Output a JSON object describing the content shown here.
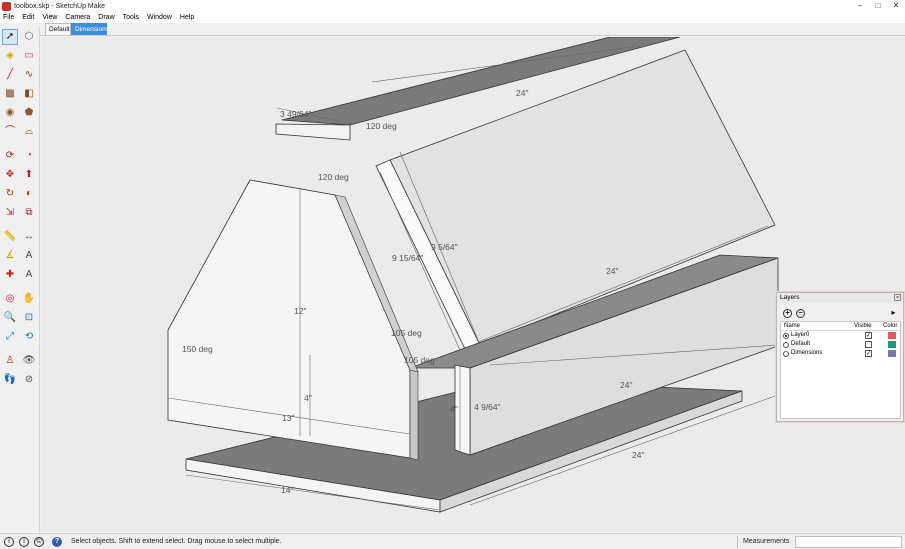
{
  "window": {
    "title": "toolbox.skp - SketchUp Make",
    "controls": {
      "minimize": "–",
      "maximize": "□",
      "close": "✕"
    }
  },
  "menu": {
    "items": [
      "File",
      "Edit",
      "View",
      "Camera",
      "Draw",
      "Tools",
      "Window",
      "Help"
    ]
  },
  "scenes": {
    "tabs": [
      {
        "label": "Default",
        "active": false
      },
      {
        "label": "Dimensions",
        "active": true
      }
    ]
  },
  "toolbar": {
    "tools": [
      "select-icon",
      "component-icon",
      "paint-bucket-icon",
      "eraser-icon",
      "line-icon",
      "freehand-icon",
      "rectangle-icon",
      "rotated-rectangle-icon",
      "circle-icon",
      "polygon-icon",
      "arc-icon",
      "two-point-arc-icon",
      "three-point-arc-icon",
      "pie-icon",
      "move-icon",
      "push-pull-icon",
      "rotate-icon",
      "follow-me-icon",
      "scale-icon",
      "offset-icon",
      "tape-measure-icon",
      "dimension-icon",
      "protractor-icon",
      "text-icon",
      "axes-icon",
      "3d-text-icon",
      "orbit-icon",
      "pan-icon",
      "zoom-icon",
      "zoom-window-icon",
      "zoom-extents-icon",
      "previous-view-icon",
      "position-camera-icon",
      "look-around-icon",
      "walk-icon",
      "section-plane-icon"
    ]
  },
  "viewport": {
    "background_color": "#ebebeb",
    "dimensions": {
      "top_width": "3 49/64\"",
      "top_angle": "120 deg",
      "top_length": "24\"",
      "side_angle": "120 deg",
      "side_panel_length": "24\"",
      "side_panel_width": "9 5/64\"",
      "slant_height": "9 15/64\"",
      "end_height": "12\"",
      "end_left_angle": "150 deg",
      "end_lower_height": "4\"",
      "end_width": "13\"",
      "front_angle_a": "105 deg",
      "front_angle_b": "105 deg",
      "front_height": "4\"",
      "front_board_height": "4 9/64\"",
      "front_length": "24\"",
      "base_length": "24\"",
      "base_width": "14\""
    }
  },
  "layers_panel": {
    "title": "Layers",
    "add_button": "+",
    "remove_button": "−",
    "details_button": "▸",
    "columns": {
      "name": "Name",
      "visible": "Visible",
      "color": "Color"
    },
    "rows": [
      {
        "name": "Layer0",
        "active": true,
        "visible": true,
        "color": "#e05a5a"
      },
      {
        "name": "Default",
        "active": false,
        "visible": false,
        "color": "#1a9a7a"
      },
      {
        "name": "Dimensions",
        "active": false,
        "visible": true,
        "color": "#7a7aa8"
      }
    ]
  },
  "statusbar": {
    "hint": "Select objects. Shift to extend select. Drag mouse to select multiple.",
    "measurements_label": "Measurements",
    "measurements_value": ""
  }
}
